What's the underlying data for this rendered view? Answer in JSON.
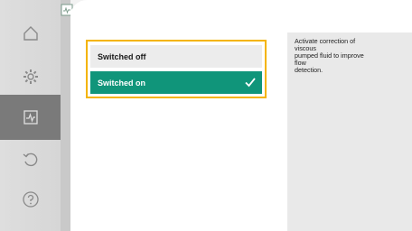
{
  "options": {
    "off_label": "Switched off",
    "on_label": "Switched on",
    "selected": "on"
  },
  "info": {
    "text": "Activate correction of\nviscous\npumped fluid to improve\nflow\ndetection."
  },
  "nav": {
    "items": [
      {
        "icon": "home-icon"
      },
      {
        "icon": "gear-icon"
      },
      {
        "icon": "diagnostics-icon",
        "active": true
      },
      {
        "icon": "undo-icon"
      },
      {
        "icon": "help-icon"
      }
    ]
  },
  "colors": {
    "accent_green": "#10957a",
    "focus_yellow": "#f4b400",
    "active_nav": "#7a7a7a"
  }
}
